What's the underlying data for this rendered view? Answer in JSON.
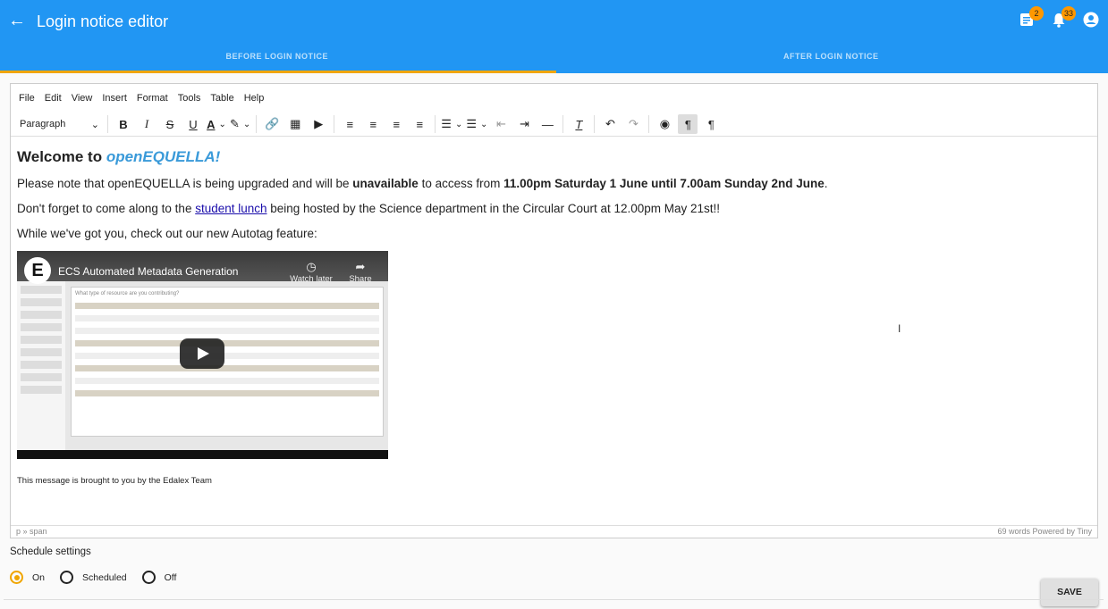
{
  "appbar": {
    "title": "Login notice editor",
    "badges": {
      "tasks": "2",
      "notifications": "33"
    }
  },
  "tabs": [
    {
      "label": "BEFORE LOGIN NOTICE"
    },
    {
      "label": "AFTER LOGIN NOTICE"
    }
  ],
  "menubar": {
    "items": [
      "File",
      "Edit",
      "View",
      "Insert",
      "Format",
      "Tools",
      "Table",
      "Help"
    ]
  },
  "toolbar": {
    "block_format": "Paragraph"
  },
  "content": {
    "heading_prefix": "Welcome to ",
    "heading_brand": "openEQUELLA!",
    "p1_a": "Please note that openEQUELLA is being upgraded and will be ",
    "p1_b": "unavailable",
    "p1_c": " to access from ",
    "p1_d": "11.00pm Saturday 1 June until 7.00am Sunday 2nd June",
    "p1_e": ".",
    "p2_a": "Don't forget to come along to the ",
    "p2_link": "student lunch",
    "p2_b": " being hosted by the Science department in the Circular Court at 12.00pm May 21st!!",
    "p3": "While we've got you, check out our new Autotag feature:",
    "video": {
      "title": "ECS Automated Metadata Generation",
      "watch_later": "Watch later",
      "share": "Share",
      "logo": "E",
      "prompt": "What type of resource are you contributing?"
    },
    "footer_msg": "This message is brought to you by the Edalex Team"
  },
  "statusbar": {
    "path": "p » span",
    "right": "69 words  Powered by Tiny"
  },
  "schedule": {
    "title": "Schedule settings",
    "options": [
      "On",
      "Scheduled",
      "Off"
    ],
    "selected": "On"
  },
  "save_label": "SAVE",
  "colors": {
    "appbar": "#2196f3",
    "accent": "#f0a500"
  }
}
